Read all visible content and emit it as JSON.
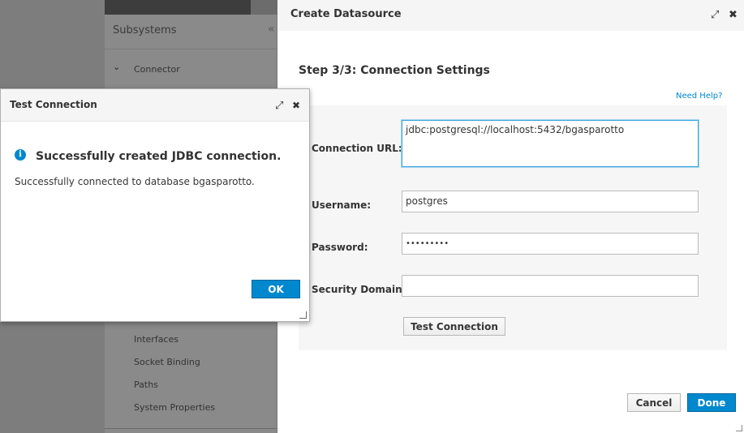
{
  "background": {
    "sidebar_title": "Subsystems",
    "connector_label": "Connector",
    "nav_items": [
      "Interfaces",
      "Socket Binding",
      "Paths",
      "System Properties"
    ]
  },
  "datasource_window": {
    "title": "Create Datasource",
    "step_title": "Step 3/3: Connection Settings",
    "help_link": "Need Help?",
    "fields": {
      "connection_url": {
        "label": "Connection URL:",
        "value": "jdbc:postgresql://localhost:5432/bgasparotto"
      },
      "username": {
        "label": "Username:",
        "value": "postgres"
      },
      "password": {
        "label": "Password:",
        "value": "•••••••••"
      },
      "security_domain": {
        "label": "Security Domain:",
        "value": ""
      }
    },
    "test_connection_button": "Test Connection",
    "cancel_button": "Cancel",
    "done_button": "Done"
  },
  "test_connection_dialog": {
    "title": "Test Connection",
    "heading": "Successfully created JDBC connection.",
    "message": "Successfully connected to database bgasparotto.",
    "ok_button": "OK"
  },
  "icons": {
    "maximize": "maximize-icon",
    "close": "close-icon",
    "info": "info-icon",
    "chevron": "chevron-down-icon",
    "collapse": "collapse-icon"
  },
  "colors": {
    "accent": "#0088ce",
    "focus_border": "#39a5dc"
  }
}
